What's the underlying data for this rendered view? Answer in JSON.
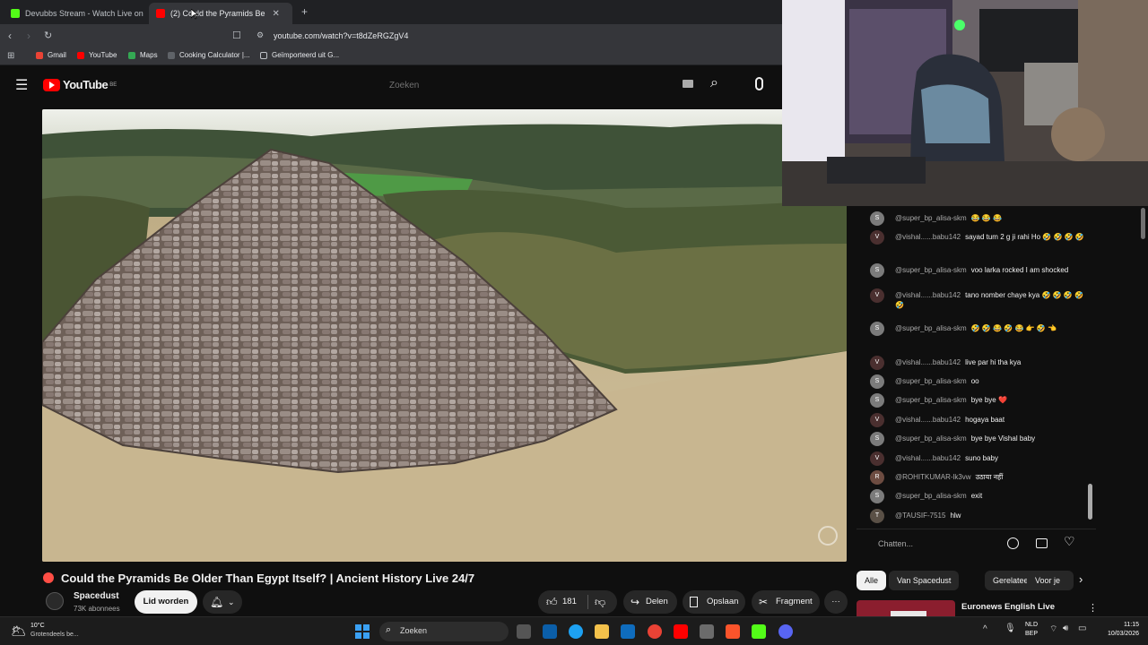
{
  "browser": {
    "tabs": [
      {
        "label": "Devubbs Stream - Watch Live on",
        "active": false
      },
      {
        "label": "(2) Could the Pyramids Be",
        "active": true
      }
    ],
    "new_tab": "+",
    "url": "youtube.com/watch?v=t8dZeRGZgV4",
    "bookmarks": [
      "Gmail",
      "YouTube",
      "Maps",
      "Cooking Calculator |...",
      "Geïmporteerd uit G..."
    ]
  },
  "youtube": {
    "logo": "YouTube",
    "logo_sup": "BE",
    "search_placeholder": "Zoeken"
  },
  "video": {
    "title": "Could the Pyramids Be Older Than Egypt Itself? | Ancient History Live 24/7",
    "channel": "Spacedust",
    "subscribers": "73K abonnees",
    "join_label": "Lid worden",
    "likes": "181",
    "share_label": "Delen",
    "save_label": "Opslaan",
    "clip_label": "Fragment",
    "more_label": "···"
  },
  "chat": {
    "messages": [
      {
        "author": "@super_bp_alisa-skm",
        "text": "😂 😂 😂",
        "avatar": "S"
      },
      {
        "author": "@vishal......babu142",
        "text": "sayad tum 2 g ji rahi Ho 🤣 🤣 🤣 🤣",
        "avatar": "V"
      },
      {
        "author": "@super_bp_alisa-skm",
        "text": "voo larka rocked I am shocked",
        "avatar": "S"
      },
      {
        "author": "@vishal......babu142",
        "text": "tano nomber chaye kya 🤣 🤣 🤣 🤣 🤣",
        "avatar": "V"
      },
      {
        "author": "@super_bp_alisa-skm",
        "text": "🤣 🤣 😂 🤣 😂 👉 🤣 👈",
        "avatar": "S"
      },
      {
        "author": "@vishal......babu142",
        "text": "live par hi tha kya",
        "avatar": "V"
      },
      {
        "author": "@super_bp_alisa-skm",
        "text": "oo",
        "avatar": "S"
      },
      {
        "author": "@super_bp_alisa-skm",
        "text": "bye bye ❤️",
        "avatar": "S"
      },
      {
        "author": "@vishal......babu142",
        "text": "hogaya baat",
        "avatar": "V"
      },
      {
        "author": "@super_bp_alisa-skm",
        "text": "bye bye Vishal baby",
        "avatar": "S"
      },
      {
        "author": "@vishal......babu142",
        "text": "suno baby",
        "avatar": "V"
      },
      {
        "author": "@ROHITKUMAR-lk3vw",
        "text": "उठाया नहीं",
        "avatar": "R"
      },
      {
        "author": "@super_bp_alisa-skm",
        "text": "exit",
        "avatar": "S"
      },
      {
        "author": "@TAUSIF-7515",
        "text": "hlw",
        "avatar": "T"
      }
    ],
    "input_placeholder": "Chatten..."
  },
  "chips": [
    "Alle",
    "Van Spacedust",
    "Gerelateerd",
    "Voor je"
  ],
  "up_next": {
    "title": "Euronews English Live"
  },
  "taskbar": {
    "weather_temp": "10°C",
    "weather_desc": "Grotendeels be...",
    "search": "Zoeken",
    "lang_top": "NLD",
    "lang_bottom": "BEP",
    "time": "11:15",
    "date": "10/03/2026"
  },
  "colors": {
    "yt_red": "#ff0000",
    "bg": "#0f0f0f",
    "chip_bg": "#272727"
  }
}
